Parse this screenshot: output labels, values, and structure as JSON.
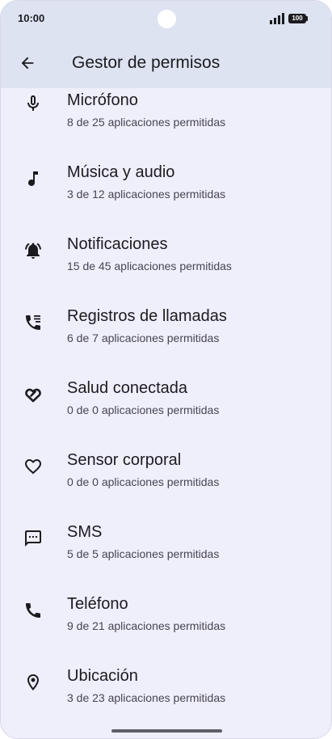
{
  "status_bar": {
    "time": "10:00",
    "battery": "100"
  },
  "app_bar": {
    "title": "Gestor de permisos"
  },
  "items": [
    {
      "title": "Micrófono",
      "subtitle": "8 de 25 aplicaciones permitidas",
      "icon": "microphone-icon"
    },
    {
      "title": "Música y audio",
      "subtitle": "3 de 12 aplicaciones permitidas",
      "icon": "music-note-icon"
    },
    {
      "title": "Notificaciones",
      "subtitle": "15 de 45 aplicaciones permitidas",
      "icon": "notification-bell-icon"
    },
    {
      "title": "Registros de llamadas",
      "subtitle": "6 de 7 aplicaciones permitidas",
      "icon": "call-log-icon"
    },
    {
      "title": "Salud conectada",
      "subtitle": "0 de 0 aplicaciones permitidas",
      "icon": "health-connect-icon"
    },
    {
      "title": "Sensor corporal",
      "subtitle": "0 de 0 aplicaciones permitidas",
      "icon": "heart-outline-icon"
    },
    {
      "title": "SMS",
      "subtitle": "5 de 5 aplicaciones permitidas",
      "icon": "sms-icon"
    },
    {
      "title": "Teléfono",
      "subtitle": "9 de 21 aplicaciones permitidas",
      "icon": "phone-icon"
    },
    {
      "title": "Ubicación",
      "subtitle": "3 de 23 aplicaciones permitidas",
      "icon": "location-pin-icon"
    }
  ]
}
